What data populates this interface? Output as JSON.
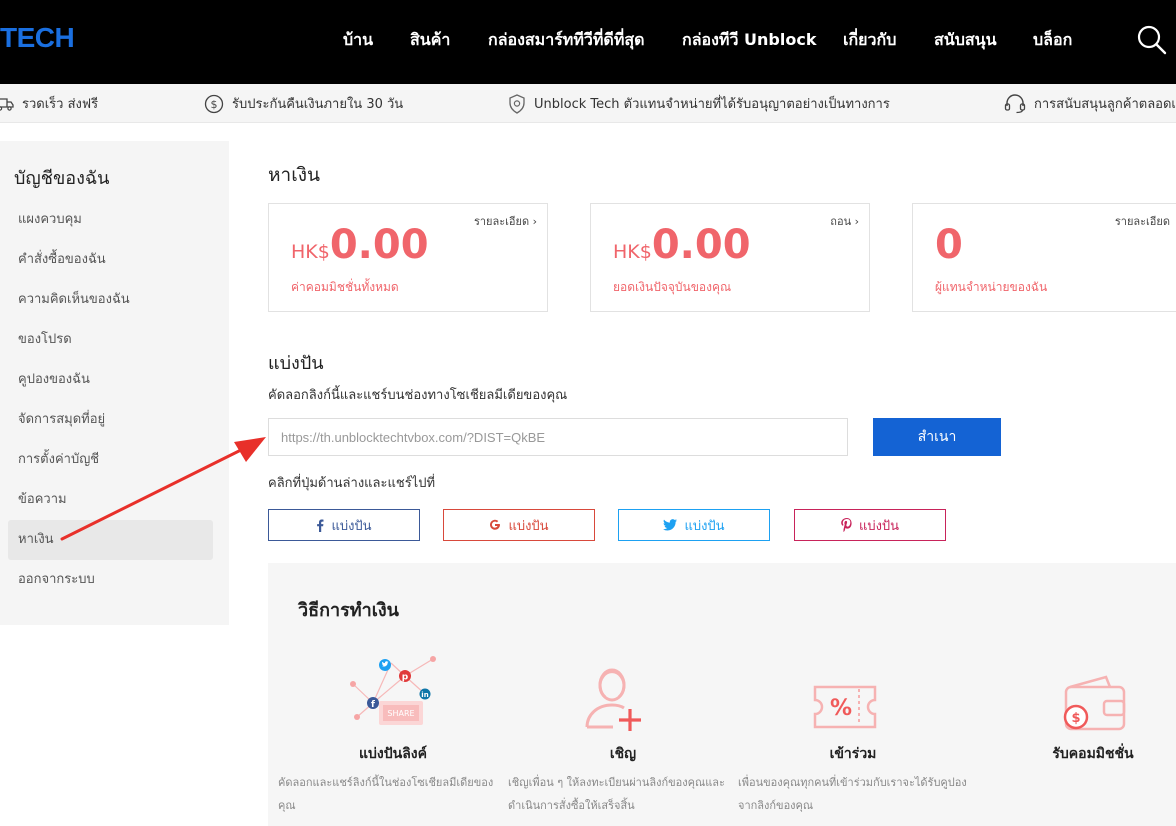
{
  "header": {
    "logo": "TECH",
    "nav": [
      "บ้าน",
      "สินค้า",
      "กล่องสมาร์ททีวีที่ดีที่สุด",
      "กล่องทีวี Unblock",
      "เกี่ยวกับ",
      "สนับสนุน",
      "บล็อก"
    ]
  },
  "infobar": [
    "รวดเร็ว ส่งฟรี",
    "รับประกันคืนเงินภายใน 30 วัน",
    "Unblock Tech ตัวแทนจำหน่ายที่ได้รับอนุญาตอย่างเป็นทางการ",
    "การสนับสนุนลูกค้าตลอดเวลา"
  ],
  "sidebar": {
    "title": "บัญชีของฉัน",
    "items": [
      "แผงควบคุม",
      "คำสั่งซื้อของฉัน",
      "ความคิดเห็นของฉัน",
      "ของโปรด",
      "คูปองของฉัน",
      "จัดการสมุดที่อยู่",
      "การตั้งค่าบัญชี",
      "ข้อความ",
      "หาเงิน",
      "ออกจากระบบ"
    ],
    "active_index": 8
  },
  "main": {
    "title": "หาเงิน",
    "cards": [
      {
        "link": "รายละเอียด",
        "currency": "HK$",
        "value": "0.00",
        "label": "ค่าคอมมิชชั่นทั้งหมด"
      },
      {
        "link": "ถอน",
        "currency": "HK$",
        "value": "0.00",
        "label": "ยอดเงินปัจจุบันของคุณ"
      },
      {
        "link": "รายละเอียด",
        "currency": "",
        "value": "0",
        "label": "ผู้แทนจำหน่ายของฉัน"
      }
    ],
    "share": {
      "title": "แบ่งปัน",
      "desc": "คัดลอกลิงก์นี้และแชร์บนช่องทางโซเชียลมีเดียของคุณ",
      "link": "https://th.unblocktechtvbox.com/?DIST=QkBE",
      "copy_label": "สำเนา",
      "hint": "คลิกที่ปุ่มด้านล่างและแชร์ไปที่",
      "buttons": [
        {
          "icon": "facebook-icon",
          "label": "แบ่งปัน",
          "color": "#3b5998"
        },
        {
          "icon": "google-icon",
          "label": "แบ่งปัน",
          "color": "#d8493b"
        },
        {
          "icon": "twitter-icon",
          "label": "แบ่งปัน",
          "color": "#1da1f2"
        },
        {
          "icon": "pinterest-icon",
          "label": "แบ่งปัน",
          "color": "#c8235a"
        }
      ]
    },
    "howto": {
      "title": "วิธีการทำเงิน",
      "share_badge": "SHARE",
      "steps": [
        {
          "title": "แบ่งปันลิงค์",
          "desc": "คัดลอกและแชร์ลิงก์นี้ในช่องโซเชียลมีเดียของคุณ"
        },
        {
          "title": "เชิญ",
          "desc": "เชิญเพื่อน ๆ ให้ลงทะเบียนผ่านลิงก์ของคุณและดำเนินการสั่งซื้อให้เสร็จสิ้น"
        },
        {
          "title": "เข้าร่วม",
          "desc": "เพื่อนของคุณทุกคนที่เข้าร่วมกับเราจะได้รับคูปองจากลิงก์ของคุณ"
        },
        {
          "title": "รับคอมมิชชั่น",
          "desc": ""
        }
      ]
    }
  },
  "colors": {
    "accent": "#1463d4",
    "money": "#f0656b",
    "arrow": "#e8302a"
  }
}
